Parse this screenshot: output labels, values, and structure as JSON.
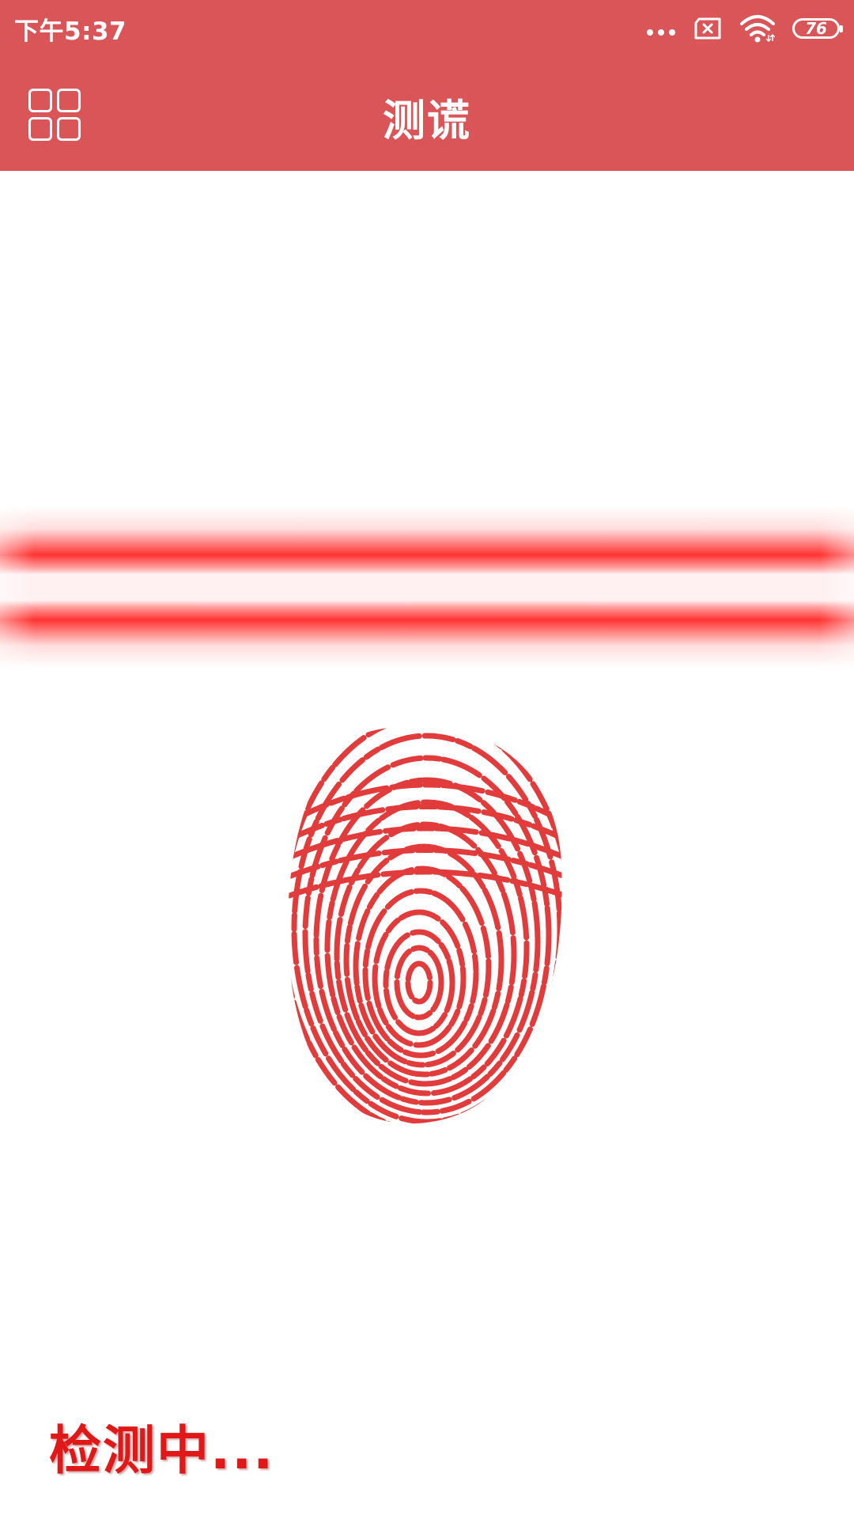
{
  "status_bar": {
    "time": "下午5:37",
    "battery_level": "76",
    "icons": [
      "more-dots-icon",
      "sim-x-icon",
      "wifi-icon",
      "battery-icon"
    ]
  },
  "app_bar": {
    "title": "测谎",
    "menu_icon": "grid-icon"
  },
  "scanner": {
    "fingerprint_icon": "fingerprint-icon"
  },
  "status_text": "检测中...",
  "colors": {
    "primary": "#d95558",
    "scan_line": "#ff2b2b",
    "fingerprint": "#e23b3b",
    "status_text": "#e01818"
  }
}
